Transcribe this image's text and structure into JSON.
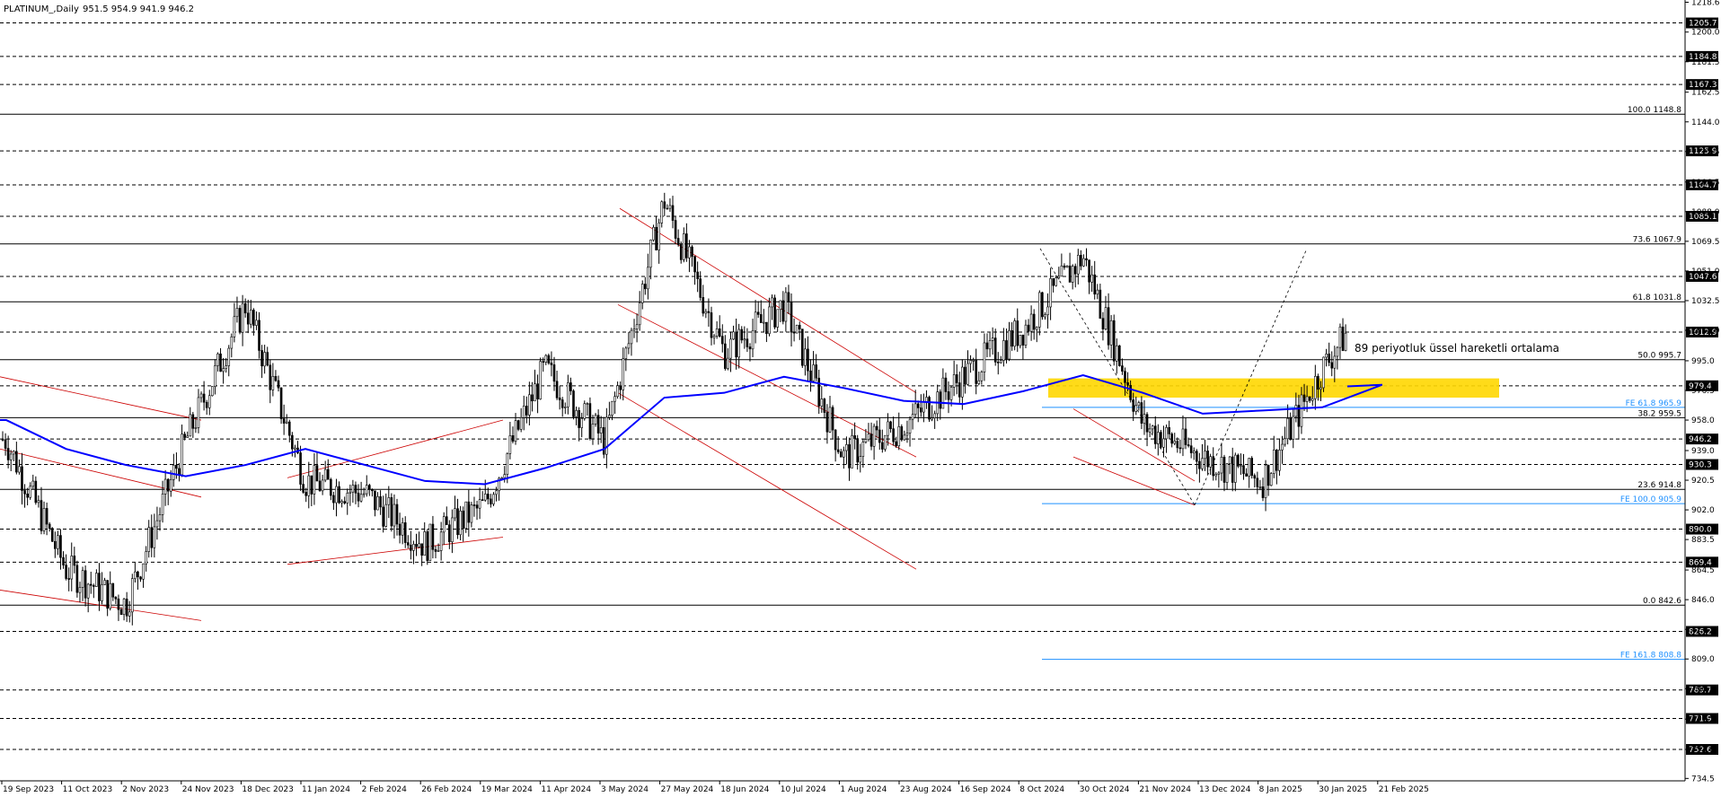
{
  "chart_data": {
    "type": "candlestick",
    "title": "PLATINUM_,Daily",
    "ohlc_header": "951.5 954.9 941.9 946.2",
    "last_price": 946.2,
    "ylim": [
      733.0,
      1220.0
    ],
    "y_ticks": [
      1218.6,
      1200.0,
      1181.5,
      1162.5,
      1144.0,
      1125.5,
      1106.5,
      1088.0,
      1069.5,
      1051.0,
      1032.5,
      1014.0,
      995.0,
      976.5,
      958.0,
      939.0,
      920.5,
      902.0,
      883.5,
      864.5,
      846.0,
      827.5,
      809.0,
      790.5,
      771.5,
      752.6,
      734.5
    ],
    "x_labels": [
      "19 Sep 2023",
      "11 Oct 2023",
      "2 Nov 2023",
      "24 Nov 2023",
      "18 Dec 2023",
      "11 Jan 2024",
      "2 Feb 2024",
      "26 Feb 2024",
      "19 Mar 2024",
      "11 Apr 2024",
      "3 May 2024",
      "27 May 2024",
      "18 Jun 2024",
      "10 Jul 2024",
      "1 Aug 2024",
      "23 Aug 2024",
      "16 Sep 2024",
      "8 Oct 2024",
      "30 Oct 2024",
      "21 Nov 2024",
      "13 Dec 2024",
      "8 Jan 2025",
      "30 Jan 2025",
      "21 Feb 2025"
    ],
    "horizontal_levels": [
      1205.7,
      1184.8,
      1167.3,
      1125.9,
      1104.7,
      1085.1,
      1047.6,
      1012.9,
      979.4,
      946.2,
      930.3,
      890.0,
      869.4,
      826.2,
      789.7,
      771.9,
      752.6
    ],
    "fibonacci_levels": [
      {
        "label": "100.0 1148.8",
        "value": 1148.8
      },
      {
        "label": "73.6 1067.9",
        "value": 1067.9
      },
      {
        "label": "61.8 1031.8",
        "value": 1031.8
      },
      {
        "label": "50.0 995.7",
        "value": 995.7
      },
      {
        "label": "38.2 959.5",
        "value": 959.5
      },
      {
        "label": "23.6 914.8",
        "value": 914.8
      },
      {
        "label": "0.0 842.6",
        "value": 842.6
      }
    ],
    "fibonacci_expansion_levels": [
      {
        "label": "FE 61.8 965.9",
        "value": 965.9
      },
      {
        "label": "FE 100.0 905.9",
        "value": 905.9
      },
      {
        "label": "FE 161.8 808.8",
        "value": 808.8
      }
    ],
    "zone": {
      "low": 972.0,
      "high": 984.0,
      "color": "#ffd700"
    },
    "annotation": "89 periyotluk üssel hareketli ortalama",
    "indicator_color": "#0000ff",
    "trendline_color": "#cc0000",
    "fib_color": "#000000",
    "fe_color": "#1e90ff",
    "key_points": [
      {
        "date": "19 Sep 2023",
        "price": 945
      },
      {
        "date": "11 Oct 2023",
        "price": 865
      },
      {
        "date": "2 Nov 2023",
        "price": 843
      },
      {
        "date": "24 Nov 2023",
        "price": 945
      },
      {
        "date": "18 Dec 2023",
        "price": 1030
      },
      {
        "date": "11 Jan 2024",
        "price": 920
      },
      {
        "date": "2 Feb 2024",
        "price": 912
      },
      {
        "date": "26 Feb 2024",
        "price": 880
      },
      {
        "date": "19 Mar 2024",
        "price": 905
      },
      {
        "date": "11 Apr 2024",
        "price": 990
      },
      {
        "date": "3 May 2024",
        "price": 945
      },
      {
        "date": "27 May 2024",
        "price": 1095
      },
      {
        "date": "18 Jun 2024",
        "price": 1000
      },
      {
        "date": "10 Jul 2024",
        "price": 1030
      },
      {
        "date": "1 Aug 2024",
        "price": 935
      },
      {
        "date": "23 Aug 2024",
        "price": 955
      },
      {
        "date": "16 Sep 2024",
        "price": 985
      },
      {
        "date": "8 Oct 2024",
        "price": 1015
      },
      {
        "date": "30 Oct 2024",
        "price": 1060
      },
      {
        "date": "21 Nov 2024",
        "price": 955
      },
      {
        "date": "13 Dec 2024",
        "price": 935
      },
      {
        "date": "8 Jan 2025",
        "price": 920
      },
      {
        "date": "30 Jan 2025",
        "price": 990
      },
      {
        "date": "21 Feb 2025",
        "price": 1045
      }
    ],
    "ema_points": [
      {
        "date": "19 Sep 2023",
        "price": 958
      },
      {
        "date": "11 Oct 2023",
        "price": 940
      },
      {
        "date": "2 Nov 2023",
        "price": 930
      },
      {
        "date": "24 Nov 2023",
        "price": 923
      },
      {
        "date": "18 Dec 2023",
        "price": 930
      },
      {
        "date": "11 Jan 2024",
        "price": 940
      },
      {
        "date": "2 Feb 2024",
        "price": 930
      },
      {
        "date": "26 Feb 2024",
        "price": 920
      },
      {
        "date": "19 Mar 2024",
        "price": 918
      },
      {
        "date": "11 Apr 2024",
        "price": 928
      },
      {
        "date": "3 May 2024",
        "price": 940
      },
      {
        "date": "27 May 2024",
        "price": 972
      },
      {
        "date": "18 Jun 2024",
        "price": 975
      },
      {
        "date": "10 Jul 2024",
        "price": 985
      },
      {
        "date": "1 Aug 2024",
        "price": 978
      },
      {
        "date": "23 Aug 2024",
        "price": 970
      },
      {
        "date": "16 Sep 2024",
        "price": 968
      },
      {
        "date": "8 Oct 2024",
        "price": 976
      },
      {
        "date": "30 Oct 2024",
        "price": 986
      },
      {
        "date": "21 Nov 2024",
        "price": 975
      },
      {
        "date": "13 Dec 2024",
        "price": 962
      },
      {
        "date": "8 Jan 2025",
        "price": 964
      },
      {
        "date": "30 Jan 2025",
        "price": 966
      },
      {
        "date": "21 Feb 2025",
        "price": 980
      }
    ]
  }
}
